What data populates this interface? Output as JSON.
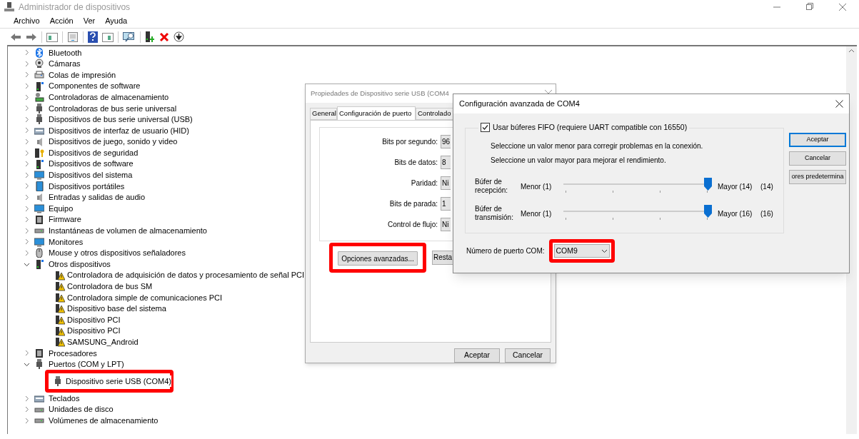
{
  "window": {
    "title": "Administrador de dispositivos"
  },
  "menu": [
    "Archivo",
    "Acción",
    "Ver",
    "Ayuda"
  ],
  "tree": [
    {
      "label": "Bluetooth",
      "kind": "bluetooth",
      "expanded": false
    },
    {
      "label": "Cámaras",
      "kind": "camera",
      "expanded": false
    },
    {
      "label": "Colas de impresión",
      "kind": "printer",
      "expanded": false
    },
    {
      "label": "Componentes de software",
      "kind": "device",
      "expanded": false
    },
    {
      "label": "Controladoras de almacenamiento",
      "kind": "storage",
      "expanded": false
    },
    {
      "label": "Controladoras de bus serie universal",
      "kind": "plug",
      "expanded": false
    },
    {
      "label": "Dispositivos de bus serie universal (USB)",
      "kind": "plug",
      "expanded": false
    },
    {
      "label": "Dispositivos de interfaz de usuario (HID)",
      "kind": "keyboard",
      "expanded": false
    },
    {
      "label": "Dispositivos de juego, sonido y video",
      "kind": "speaker",
      "expanded": false
    },
    {
      "label": "Dispositivos de seguridad",
      "kind": "key",
      "expanded": false
    },
    {
      "label": "Dispositivos de software",
      "kind": "device",
      "expanded": false
    },
    {
      "label": "Dispositivos del sistema",
      "kind": "monitor",
      "expanded": false
    },
    {
      "label": "Dispositivos portátiles",
      "kind": "tablet",
      "expanded": false
    },
    {
      "label": "Entradas y salidas de audio",
      "kind": "speaker",
      "expanded": false
    },
    {
      "label": "Equipo",
      "kind": "monitor",
      "expanded": false
    },
    {
      "label": "Firmware",
      "kind": "chip",
      "expanded": false
    },
    {
      "label": "Instantáneas de volumen de almacenamiento",
      "kind": "drive",
      "expanded": false
    },
    {
      "label": "Monitores",
      "kind": "monitor",
      "expanded": false
    },
    {
      "label": "Mouse y otros dispositivos señaladores",
      "kind": "mouse",
      "expanded": false
    },
    {
      "label": "Otros dispositivos",
      "kind": "device",
      "expanded": true,
      "children": [
        {
          "label": "Controladora de adquisición de datos y procesamiento de señal PCI",
          "kind": "warning",
          "annotated": false
        },
        {
          "label": "Controladora de bus SM",
          "kind": "warning",
          "annotated": false
        },
        {
          "label": "Controladora simple de comunicaciones PCI",
          "kind": "warning",
          "annotated": false
        },
        {
          "label": "Dispositivo base del sistema",
          "kind": "warning",
          "annotated": false
        },
        {
          "label": "Dispositivo PCI",
          "kind": "warning",
          "annotated": false
        },
        {
          "label": "Dispositivo PCI",
          "kind": "warning",
          "annotated": false
        },
        {
          "label": "SAMSUNG_Android",
          "kind": "warning",
          "annotated": false
        }
      ]
    },
    {
      "label": "Procesadores",
      "kind": "chip",
      "expanded": false
    },
    {
      "label": "Puertos (COM y LPT)",
      "kind": "plug",
      "expanded": true,
      "children": [
        {
          "label": "Dispositivo serie USB (COM4)",
          "kind": "plug",
          "annotated": true
        }
      ]
    },
    {
      "label": "Teclados",
      "kind": "keyboard",
      "expanded": false
    },
    {
      "label": "Unidades de disco",
      "kind": "drive",
      "expanded": false
    },
    {
      "label": "Volúmenes de almacenamiento",
      "kind": "drive",
      "expanded": false
    }
  ],
  "properties_dialog": {
    "title": "Propiedades de Dispositivo serie USB (COM4",
    "tabs": [
      {
        "label": "General",
        "selected": false
      },
      {
        "label": "Configuración de puerto",
        "selected": true
      },
      {
        "label": "Controlado",
        "selected": false
      }
    ],
    "fields": [
      {
        "label": "Bits por segundo:",
        "value": "96"
      },
      {
        "label": "Bits de datos:",
        "value": "8"
      },
      {
        "label": "Paridad:",
        "value": "Ni"
      },
      {
        "label": "Bits de parada:",
        "value": "1"
      },
      {
        "label": "Control de flujo:",
        "value": "Ni"
      }
    ],
    "advanced_button": {
      "label": "Opciones avanzadas...",
      "annotated": true
    },
    "restore_button": {
      "label": "Resta"
    },
    "buttons": [
      "Aceptar",
      "Cancelar"
    ]
  },
  "advanced_dialog": {
    "title": "Configuración avanzada de COM4",
    "fifo": {
      "label": "Usar búferes FIFO (requiere UART compatible con 16550)",
      "checked": true
    },
    "hints": [
      "Seleccione un valor menor para corregir problemas en la conexión.",
      "Seleccione un valor mayor para mejorar el rendimiento."
    ],
    "buffers": [
      {
        "label": "Búfer de recepción:",
        "min": "Menor (1)",
        "max": "Mayor (14)",
        "reading": "(14)",
        "level": 1
      },
      {
        "label": "Búfer de transmisión:",
        "min": "Menor (1)",
        "max": "Mayor (16)",
        "reading": "(16)",
        "level": 1
      }
    ],
    "com_port": {
      "label": "Número de puerto COM:",
      "value": "COM9",
      "annotated": true
    },
    "buttons": [
      {
        "label": "Aceptar",
        "default": true
      },
      {
        "label": "Cancelar",
        "default": false
      },
      {
        "label": "ores predetermina",
        "default": false
      }
    ]
  }
}
